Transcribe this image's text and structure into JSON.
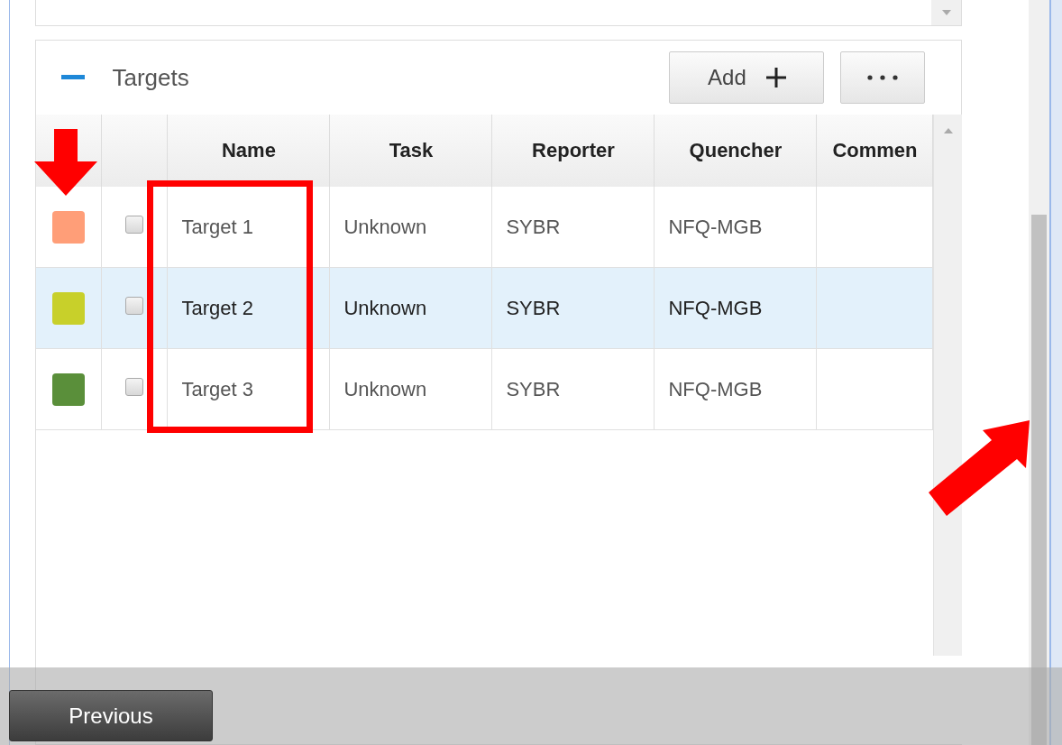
{
  "section": {
    "title": "Targets",
    "expanded": true,
    "add_button": "Add"
  },
  "table": {
    "columns": [
      "Name",
      "Task",
      "Reporter",
      "Quencher",
      "Commen"
    ],
    "rows": [
      {
        "color": "#ff9e78",
        "checked": false,
        "selected": false,
        "cells": [
          "Target 1",
          "Unknown",
          "SYBR",
          "NFQ-MGB"
        ]
      },
      {
        "color": "#c8d02a",
        "checked": false,
        "selected": true,
        "cells": [
          "Target 2",
          "Unknown",
          "SYBR",
          "NFQ-MGB"
        ]
      },
      {
        "color": "#5a8f3a",
        "checked": false,
        "selected": false,
        "cells": [
          "Target 3",
          "Unknown",
          "SYBR",
          "NFQ-MGB"
        ]
      }
    ]
  },
  "footer": {
    "previous_button": "Previous"
  }
}
